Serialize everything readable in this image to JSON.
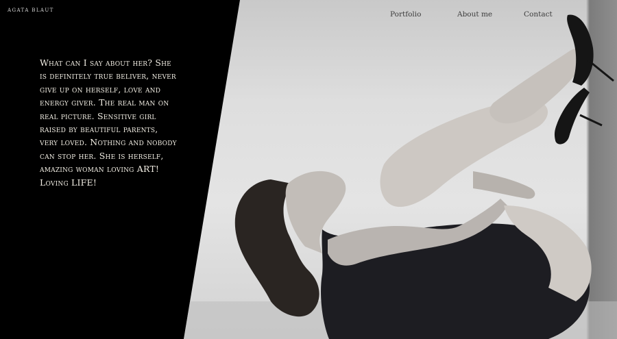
{
  "brand": {
    "name": "Agata Blaut"
  },
  "nav": {
    "items": [
      {
        "label": "Portfolio"
      },
      {
        "label": "About me"
      },
      {
        "label": "Contact"
      }
    ]
  },
  "about": {
    "text": "What can I say about her? She is definitely true beliver, never give up on herself, love and energy giver. The real man on real picture. Sensitive girl raised by beautiful parents, very loved. Nothing and nobody can stop her. She is herself, amazing woman loving ART! Loving LIFE!"
  },
  "photo": {
    "style": "black-and-white portrait",
    "icon": "photo-image"
  }
}
